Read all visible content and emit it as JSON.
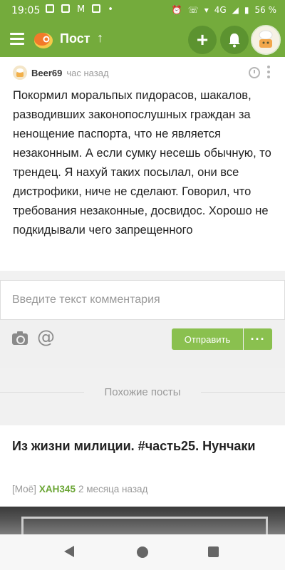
{
  "status_bar": {
    "time": "19:05",
    "network": "4G",
    "battery": "56 %"
  },
  "app_bar": {
    "title": "Пост",
    "up_arrow": "↑",
    "add_label": "+"
  },
  "post": {
    "author": "Beer69",
    "time_ago": "час назад",
    "text": "Покормил моральпых пидорасов, шакалов, разводивших законопослушных граждан за ненощение паспорта, что не является незаконным. А если сумку несешь обычную, то трендец. Я нахуй таких посылал, они все дистрофики, ниче не сделают. Говорил, что требования незаконные, досвидос. Хорошо не подкидывали чего запрещенного"
  },
  "comment": {
    "placeholder": "Введите текст комментария",
    "at_symbol": "@",
    "send_label": "Отправить",
    "more_label": "···"
  },
  "similar": {
    "label": "Похожие посты"
  },
  "card": {
    "title": "Из жизни милиции. #часть25. Нунчаки",
    "tag": "[Моё]",
    "author": "ХАН345",
    "time_ago": "2 месяца назад"
  },
  "colors": {
    "brand": "#74ab3c",
    "button": "#8ac04f",
    "author_link": "#6aa534"
  }
}
